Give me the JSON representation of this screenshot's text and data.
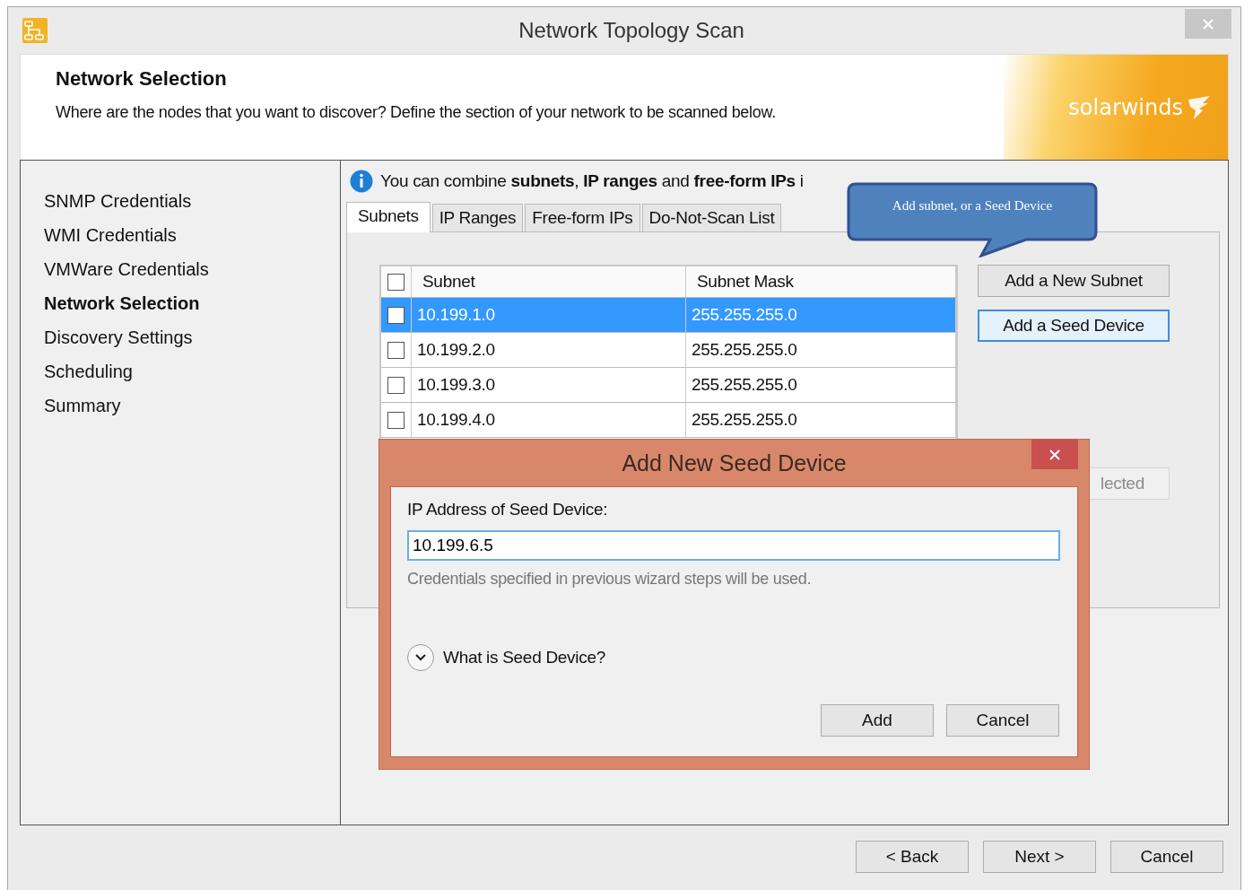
{
  "window": {
    "title": "Network Topology Scan"
  },
  "header": {
    "title": "Network Selection",
    "subtitle": "Where are the nodes that you want to discover? Define the section of your network to be scanned below.",
    "logo": "solarwinds"
  },
  "sidebar": {
    "items": [
      {
        "label": "SNMP Credentials",
        "selected": false
      },
      {
        "label": "WMI Credentials",
        "selected": false
      },
      {
        "label": "VMWare Credentials",
        "selected": false
      },
      {
        "label": "Network Selection",
        "selected": true
      },
      {
        "label": "Discovery Settings",
        "selected": false
      },
      {
        "label": "Scheduling",
        "selected": false
      },
      {
        "label": "Summary",
        "selected": false
      }
    ]
  },
  "info": "You can combine **subnets**, **IP ranges** and **free-form IPs** i",
  "callout": "Add subnet, or a Seed Device",
  "tabs": [
    {
      "label": "Subnets",
      "selected": true
    },
    {
      "label": "IP Ranges",
      "selected": false
    },
    {
      "label": "Free-form IPs",
      "selected": false
    },
    {
      "label": "Do-Not-Scan List",
      "selected": false
    }
  ],
  "table": {
    "header_checked": false,
    "columns": [
      "Subnet",
      "Subnet Mask"
    ],
    "rows": [
      {
        "subnet": "10.199.1.0",
        "mask": "255.255.255.0",
        "checked": false,
        "selected": true
      },
      {
        "subnet": "10.199.2.0",
        "mask": "255.255.255.0",
        "checked": false,
        "selected": false
      },
      {
        "subnet": "10.199.3.0",
        "mask": "255.255.255.0",
        "checked": false,
        "selected": false
      },
      {
        "subnet": "10.199.4.0",
        "mask": "255.255.255.0",
        "checked": false,
        "selected": false
      }
    ]
  },
  "side_buttons": [
    {
      "label": "Add a New Subnet",
      "disabled": false,
      "focused": false
    },
    {
      "label": "Add a Seed Device",
      "disabled": false,
      "focused": true
    },
    {
      "label": "lected",
      "disabled": true,
      "focused": false
    }
  ],
  "dialog": {
    "title": "Add New Seed Device",
    "field_label": "IP Address of Seed Device:",
    "field_value": "10.199.6.5",
    "note": "Credentials specified in previous wizard steps will be used.",
    "expander": {
      "label": "What is Seed Device?",
      "expanded": false
    },
    "buttons": [
      "Add",
      "Cancel"
    ]
  },
  "footer_buttons": [
    "< Back",
    "Next >",
    "Cancel"
  ]
}
